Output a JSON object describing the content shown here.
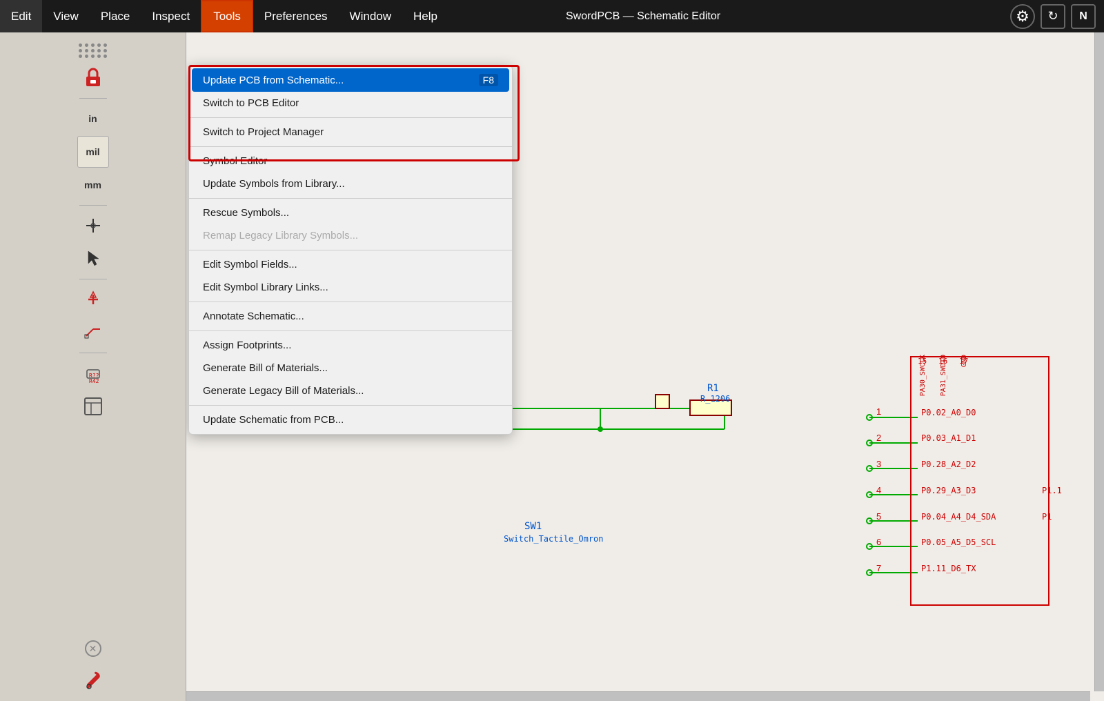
{
  "app": {
    "title": "SwordPCB — Schematic Editor"
  },
  "menubar": {
    "items": [
      {
        "id": "edit",
        "label": "Edit"
      },
      {
        "id": "view",
        "label": "View"
      },
      {
        "id": "place",
        "label": "Place"
      },
      {
        "id": "inspect",
        "label": "Inspect"
      },
      {
        "id": "tools",
        "label": "Tools"
      },
      {
        "id": "preferences",
        "label": "Preferences"
      },
      {
        "id": "window",
        "label": "Window"
      },
      {
        "id": "help",
        "label": "Help"
      }
    ]
  },
  "tools_menu": {
    "items": [
      {
        "id": "update-pcb",
        "label": "Update PCB from Schematic...",
        "shortcut": "F8",
        "highlighted": true,
        "disabled": false
      },
      {
        "id": "switch-pcb",
        "label": "Switch to PCB Editor",
        "shortcut": "",
        "highlighted": false,
        "disabled": false
      },
      {
        "id": "sep1",
        "type": "separator"
      },
      {
        "id": "switch-pm",
        "label": "Switch to Project Manager",
        "shortcut": "",
        "highlighted": false,
        "disabled": false
      },
      {
        "id": "sep2",
        "type": "separator"
      },
      {
        "id": "symbol-editor",
        "label": "Symbol Editor",
        "shortcut": "",
        "highlighted": false,
        "disabled": false
      },
      {
        "id": "update-symbols",
        "label": "Update Symbols from Library...",
        "shortcut": "",
        "highlighted": false,
        "disabled": false
      },
      {
        "id": "sep3",
        "type": "separator"
      },
      {
        "id": "rescue-symbols",
        "label": "Rescue Symbols...",
        "shortcut": "",
        "highlighted": false,
        "disabled": false
      },
      {
        "id": "remap-legacy",
        "label": "Remap Legacy Library Symbols...",
        "shortcut": "",
        "highlighted": false,
        "disabled": true
      },
      {
        "id": "sep4",
        "type": "separator"
      },
      {
        "id": "edit-symbol-fields",
        "label": "Edit Symbol Fields...",
        "shortcut": "",
        "highlighted": false,
        "disabled": false
      },
      {
        "id": "edit-symbol-library",
        "label": "Edit Symbol Library Links...",
        "shortcut": "",
        "highlighted": false,
        "disabled": false
      },
      {
        "id": "sep5",
        "type": "separator"
      },
      {
        "id": "annotate-schematic",
        "label": "Annotate Schematic...",
        "shortcut": "",
        "highlighted": false,
        "disabled": false
      },
      {
        "id": "sep6",
        "type": "separator"
      },
      {
        "id": "assign-footprints",
        "label": "Assign Footprints...",
        "shortcut": "",
        "highlighted": false,
        "disabled": false
      },
      {
        "id": "gen-bom",
        "label": "Generate Bill of Materials...",
        "shortcut": "",
        "highlighted": false,
        "disabled": false
      },
      {
        "id": "gen-legacy-bom",
        "label": "Generate Legacy Bill of Materials...",
        "shortcut": "",
        "highlighted": false,
        "disabled": false
      },
      {
        "id": "sep7",
        "type": "separator"
      },
      {
        "id": "update-schematic-pcb",
        "label": "Update Schematic from PCB...",
        "shortcut": "",
        "highlighted": false,
        "disabled": false
      }
    ]
  },
  "toolbar": {
    "unit_labels": [
      "in",
      "mil",
      "mm"
    ],
    "tools": [
      "pointer",
      "add-power",
      "add-wire",
      "add-bus",
      "no-connect",
      "add-label",
      "add-global-label",
      "add-hier-label",
      "add-component",
      "add-image"
    ]
  },
  "schematic": {
    "components": [
      {
        "label": "SW1",
        "sublabel": "Switch_Tactile_Omron"
      },
      {
        "label": "R1",
        "sublabel": "R_1206"
      }
    ],
    "pin_labels": [
      "P0.02_A0_D0",
      "P0.03_A1_D1",
      "P0.28_A2_D2",
      "P0.29_A3_D3",
      "P0.04_A4_D4_SDA",
      "P0.05_A5_D5_SCL",
      "P1.11_D6_TX"
    ]
  },
  "icons": {
    "settings": "⚙",
    "close": "✕",
    "wrench": "🔧",
    "lock": "🔒",
    "cursor": "↖",
    "power": "⚡",
    "wire": "✏",
    "component": "📦",
    "script": "☰",
    "wrench2": "🔨"
  }
}
